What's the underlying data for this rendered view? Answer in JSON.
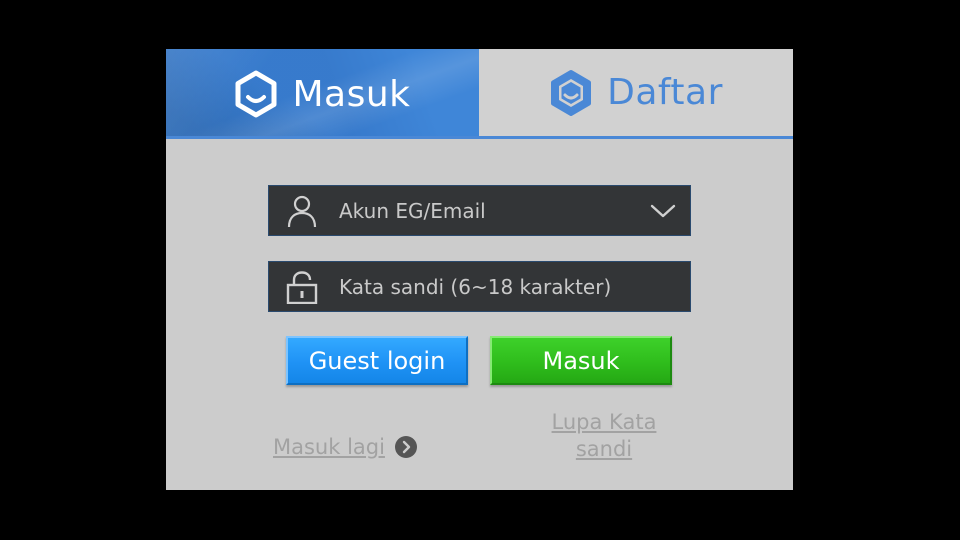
{
  "tabs": {
    "login_label": "Masuk",
    "register_label": "Daftar"
  },
  "form": {
    "account": {
      "placeholder": "Akun EG/Email",
      "value": ""
    },
    "password": {
      "placeholder": "Kata sandi (6~18 karakter)",
      "value": ""
    }
  },
  "buttons": {
    "guest_label": "Guest login",
    "login_label": "Masuk"
  },
  "links": {
    "relogin_label": "Masuk lagi",
    "forgot_label": "Lupa Kata sandi"
  },
  "icons": {
    "tab_login": "hexagon-logo-icon",
    "tab_register": "hexagon-logo-icon",
    "account": "user-icon",
    "account_dropdown": "chevron-down-icon",
    "password": "lock-icon",
    "relogin": "arrow-circle-right-icon"
  },
  "colors": {
    "active_tab": "#3f86d8",
    "accent": "#4a88d6",
    "panel": "#cccccc",
    "field": "#333537",
    "guest_button": "#1f92f5",
    "login_button": "#2fbd1c",
    "link": "#a2a2a2"
  }
}
